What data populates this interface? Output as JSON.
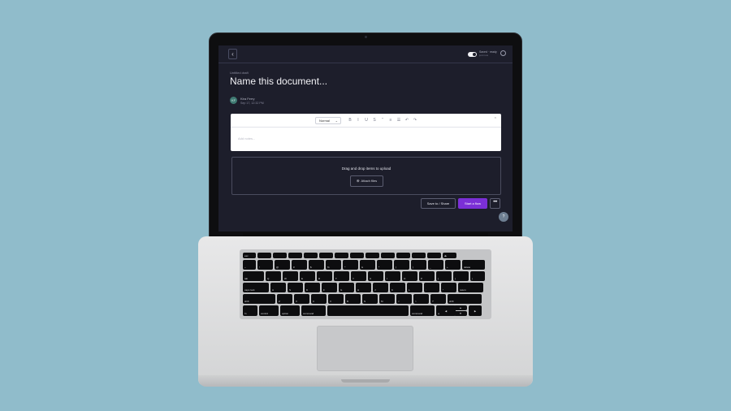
{
  "topbar": {
    "back_icon": "chevron-left-icon",
    "autosave_label": "Saved · ready",
    "autosave_sub": "just now",
    "history_icon": "clock-icon"
  },
  "document": {
    "breadcrumb": "Untitled draft",
    "title": "Name this document...",
    "author_initials": "KF",
    "author_name": "Kira Ferry",
    "date": "Sep 17, 12:32 PM"
  },
  "editor": {
    "format_value": "Normal",
    "tools": [
      "B",
      "I",
      "U",
      "S",
      "“",
      "≡",
      "☰",
      "↶",
      "↷"
    ],
    "placeholder": "Add notes..."
  },
  "dropzone": {
    "text": "Drag and drop items to upload",
    "attach_label": "Attach files",
    "attach_icon": "paperclip-icon"
  },
  "actions": {
    "save_label": "Save to / Share",
    "start_label": "Start a flow",
    "more_label": "•••",
    "help_label": "?"
  },
  "colors": {
    "background": "#90bccb",
    "screen_bg": "#1d1e2b",
    "accent": "#7b2fd6"
  },
  "keyboard": {
    "row1": [
      "esc",
      "",
      "",
      "",
      "",
      "",
      "",
      "",
      "",
      "",
      "",
      "",
      "",
      "⏏"
    ],
    "row2": [
      "~",
      "!",
      "@",
      "#",
      "$",
      "%",
      "^",
      "&",
      "*",
      "(",
      ")",
      "_",
      "+",
      "delete"
    ],
    "row3": [
      "tab",
      "Q",
      "W",
      "E",
      "R",
      "T",
      "Y",
      "U",
      "I",
      "O",
      "P",
      "{",
      "}",
      "|"
    ],
    "row4": [
      "caps lock",
      "A",
      "S",
      "D",
      "F",
      "G",
      "H",
      "J",
      "K",
      "L",
      ":",
      "\"",
      "return"
    ],
    "row5": [
      "shift",
      "Z",
      "X",
      "C",
      "V",
      "B",
      "N",
      "M",
      "<",
      ">",
      "?",
      "shift"
    ],
    "row6": [
      "fn",
      "control",
      "option",
      "command",
      "",
      "command",
      "option"
    ]
  }
}
